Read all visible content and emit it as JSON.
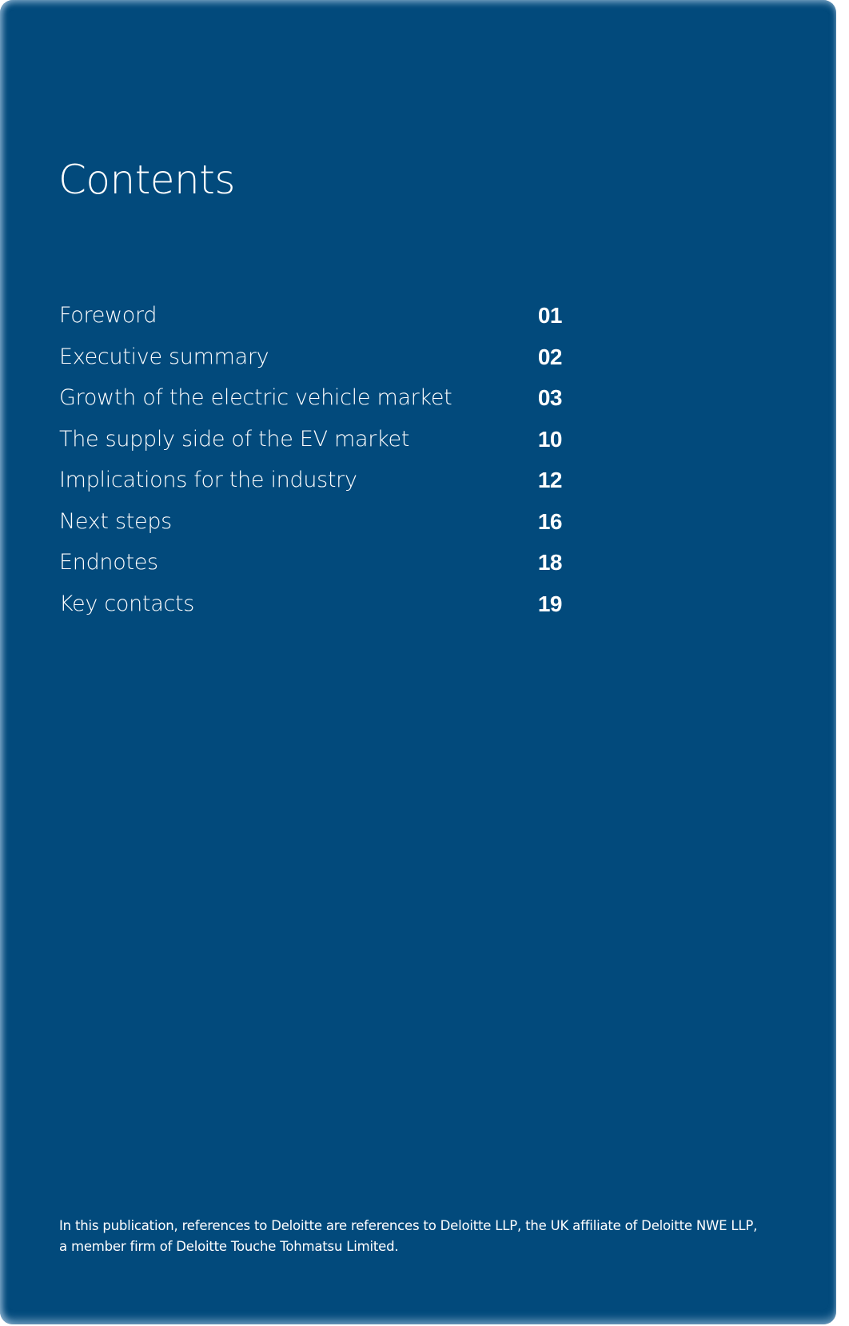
{
  "page": {
    "background_color": "#024a7c",
    "text_color": "#ffffff"
  },
  "title": "Contents",
  "toc": [
    {
      "label": "Foreword",
      "page": "01"
    },
    {
      "label": "Executive summary",
      "page": "02"
    },
    {
      "label": "Growth of the electric vehicle market",
      "page": "03"
    },
    {
      "label": "The supply side of the EV market",
      "page": "10"
    },
    {
      "label": "Implications for the industry",
      "page": "12"
    },
    {
      "label": "Next steps",
      "page": "16"
    },
    {
      "label": "Endnotes",
      "page": "18"
    },
    {
      "label": "Key contacts",
      "page": "19"
    }
  ],
  "footer": {
    "line1": "In this publication, references to Deloitte are references to Deloitte LLP, the UK affiliate of Deloitte NWE LLP,",
    "line2": "a member firm of Deloitte Touche Tohmatsu Limited."
  }
}
